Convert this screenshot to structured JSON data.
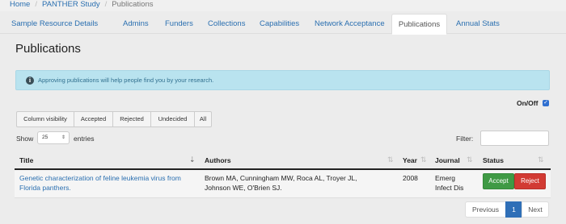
{
  "breadcrumb": {
    "items": [
      "Home",
      "PANTHER Study",
      "Publications"
    ],
    "separator": "/"
  },
  "tabs": [
    {
      "label": "Sample Resource Details",
      "active": false
    },
    {
      "label": "Admins",
      "active": false
    },
    {
      "label": "Funders",
      "active": false
    },
    {
      "label": "Collections",
      "active": false
    },
    {
      "label": "Capabilities",
      "active": false
    },
    {
      "label": "Network Acceptance",
      "active": false
    },
    {
      "label": "Publications",
      "active": true
    },
    {
      "label": "Annual Stats",
      "active": false
    }
  ],
  "page": {
    "title": "Publications"
  },
  "alert": {
    "icon": "info-circle-icon",
    "text": "Approving publications will help people find you by your research."
  },
  "onoff": {
    "label": "On/Off",
    "checked": true
  },
  "filter_buttons": [
    "Column visibility",
    "Accepted",
    "Rejected",
    "Undecided",
    "All"
  ],
  "length": {
    "show_label": "Show",
    "value": "25",
    "entries_label": "entries"
  },
  "filter": {
    "label": "Filter:",
    "value": ""
  },
  "table": {
    "columns": [
      "Title",
      "Authors",
      "Year",
      "Journal",
      "Status"
    ],
    "rows": [
      {
        "title_line1": "Genetic characterization of feline leukemia virus from",
        "title_line2": "Florida panthers.",
        "authors_line1": "Brown MA, Cunningham MW, Roca AL, Troyer JL,",
        "authors_line2": "Johnson WE, O'Brien SJ.",
        "year": "2008",
        "journal_line1": "Emerg",
        "journal_line2": "Infect Dis",
        "accept_label": "Accept",
        "reject_label": "Reject"
      }
    ]
  },
  "pagination": {
    "previous": "Previous",
    "current": "1",
    "next": "Next"
  },
  "colors": {
    "link": "#2a6fb0",
    "alert_bg": "#b9e3ef",
    "accept": "#3f9a45",
    "reject": "#d23b34",
    "page_active": "#2f6fb7"
  }
}
